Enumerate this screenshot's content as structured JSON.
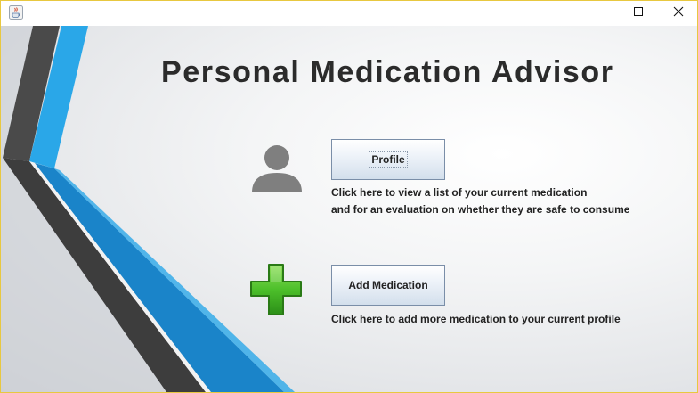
{
  "window": {
    "icon": "java-coffee-cup-icon",
    "controls": {
      "minimize_icon": "minimize-icon",
      "maximize_icon": "maximize-icon",
      "close_icon": "close-icon"
    }
  },
  "main": {
    "title": "Personal Medication Advisor",
    "profile": {
      "icon": "user-silhouette-icon",
      "button_label": "Profile",
      "description_line1": "Click here to view a list of your current medication",
      "description_line2": "and for an evaluation on whether they are safe to consume"
    },
    "add_medication": {
      "icon": "green-plus-icon",
      "button_label": "Add Medication",
      "description": "Click here to add more medication to your current profile"
    }
  },
  "colors": {
    "accent_blue": "#2aa7e8",
    "dark_stripe": "#3d3d3d",
    "plus_green": "#4cbf2a",
    "title_text": "#2b2b2b"
  }
}
